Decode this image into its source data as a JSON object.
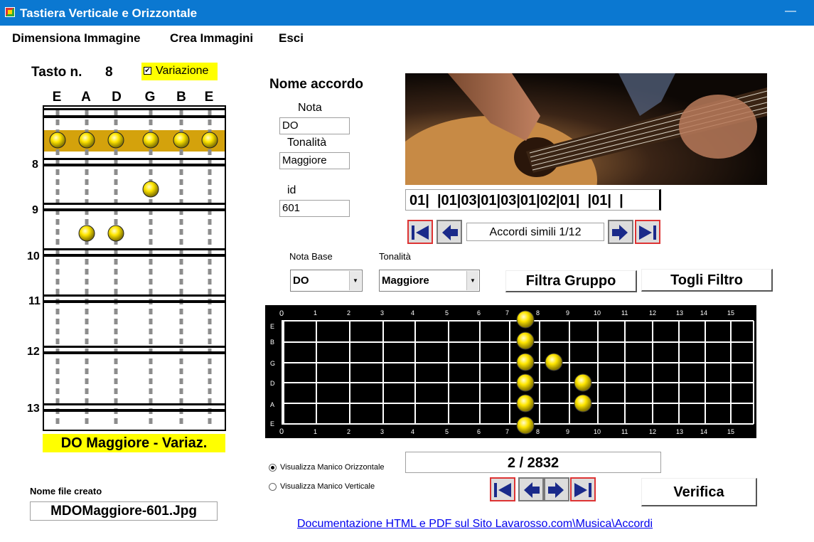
{
  "window": {
    "title": "Tastiera Verticale e Orizzontale"
  },
  "menu": {
    "items": [
      "Dimensiona Immagine",
      "Crea Immagini",
      "Esci"
    ]
  },
  "left": {
    "tasto_label": "Tasto n.",
    "tasto_value": "8",
    "variazione_label": "Variazione",
    "variazione_checked": "✔",
    "strings": [
      "E",
      "A",
      "D",
      "G",
      "B",
      "E"
    ],
    "fret_numbers": [
      "8",
      "9",
      "10",
      "11",
      "12",
      "13"
    ],
    "chord_name": "DO Maggiore - Variaz.",
    "file_label": "Nome file creato",
    "file_name": "MDOMaggiore-601.Jpg"
  },
  "chord": {
    "heading": "Nome accordo",
    "nota_label": "Nota",
    "nota_value": "DO",
    "tonalita_label": "Tonalità",
    "tonalita_value": "Maggiore",
    "id_label": "id",
    "id_value": "601"
  },
  "codes": "01|  |01|03|01|03|01|02|01|  |01|  |",
  "similar": {
    "label": "Accordi simili 1/12"
  },
  "filter": {
    "nota_base_label": "Nota Base",
    "nota_base_value": "DO",
    "tonalita_label": "Tonalità",
    "tonalita_value": "Maggiore",
    "filtra_button": "Filtra Gruppo",
    "togli_button": "Togli Filtro"
  },
  "horizontal": {
    "fret_labels": [
      "0",
      "1",
      "2",
      "3",
      "4",
      "5",
      "6",
      "7",
      "8",
      "9",
      "10",
      "11",
      "12",
      "13",
      "14",
      "15"
    ],
    "string_labels": [
      "E",
      "B",
      "G",
      "D",
      "A",
      "E"
    ]
  },
  "view": {
    "horizontal_label": "Visualizza Manico Orizzontale",
    "vertical_label": "Visualizza Manico Verticale",
    "selected": "horizontal"
  },
  "counter": "2 / 2832",
  "verify_button": "Verifica",
  "doc_link": "Documentazione HTML e PDF sul Sito Lavarosso.com\\Musica\\Accordi",
  "colors": {
    "titlebar": "#0b78d1",
    "highlight": "#ffff00",
    "fret_highlight": "#d4a20c",
    "note": "#ffe600"
  },
  "icons": {
    "nav_first": "first-arrow-icon",
    "nav_prev": "prev-arrow-icon",
    "nav_next": "next-arrow-icon",
    "nav_last": "last-arrow-icon"
  }
}
